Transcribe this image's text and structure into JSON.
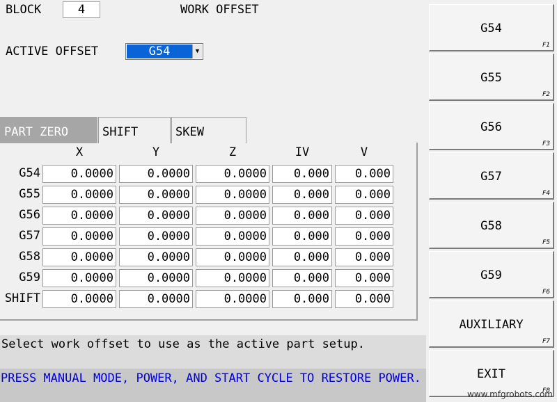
{
  "header": {
    "block_label": "BLOCK",
    "block_value": "4",
    "title": "WORK OFFSET",
    "active_offset_label": "ACTIVE OFFSET",
    "active_offset_value": "G54"
  },
  "tabs": [
    {
      "label": "PART ZERO",
      "active": true
    },
    {
      "label": "SHIFT",
      "active": false
    },
    {
      "label": "SKEW",
      "active": false
    }
  ],
  "table": {
    "columns": [
      "X",
      "Y",
      "Z",
      "IV",
      "V"
    ],
    "rows": [
      {
        "label": "G54",
        "values": [
          "0.0000",
          "0.0000",
          "0.0000",
          "0.000",
          "0.000"
        ]
      },
      {
        "label": "G55",
        "values": [
          "0.0000",
          "0.0000",
          "0.0000",
          "0.000",
          "0.000"
        ]
      },
      {
        "label": "G56",
        "values": [
          "0.0000",
          "0.0000",
          "0.0000",
          "0.000",
          "0.000"
        ]
      },
      {
        "label": "G57",
        "values": [
          "0.0000",
          "0.0000",
          "0.0000",
          "0.000",
          "0.000"
        ]
      },
      {
        "label": "G58",
        "values": [
          "0.0000",
          "0.0000",
          "0.0000",
          "0.000",
          "0.000"
        ]
      },
      {
        "label": "G59",
        "values": [
          "0.0000",
          "0.0000",
          "0.0000",
          "0.000",
          "0.000"
        ]
      },
      {
        "label": "SHIFT",
        "values": [
          "0.0000",
          "0.0000",
          "0.0000",
          "0.000",
          "0.000"
        ]
      }
    ]
  },
  "messages": {
    "info": "Select work offset to use as the active part setup.",
    "warning": "PRESS MANUAL MODE, POWER, AND START CYCLE TO RESTORE POWER."
  },
  "function_keys": [
    {
      "label": "G54",
      "key": "F1"
    },
    {
      "label": "G55",
      "key": "F2"
    },
    {
      "label": "G56",
      "key": "F3"
    },
    {
      "label": "G57",
      "key": "F4"
    },
    {
      "label": "G58",
      "key": "F5"
    },
    {
      "label": "G59",
      "key": "F6"
    },
    {
      "label": "AUXILIARY",
      "key": "F7"
    },
    {
      "label": "EXIT",
      "key": "F8"
    }
  ],
  "watermark": "www.mfgrobots.com",
  "colors": {
    "selection": "#0a64d8",
    "warning_text": "#0000e0",
    "active_tab": "#a6a6a6"
  }
}
